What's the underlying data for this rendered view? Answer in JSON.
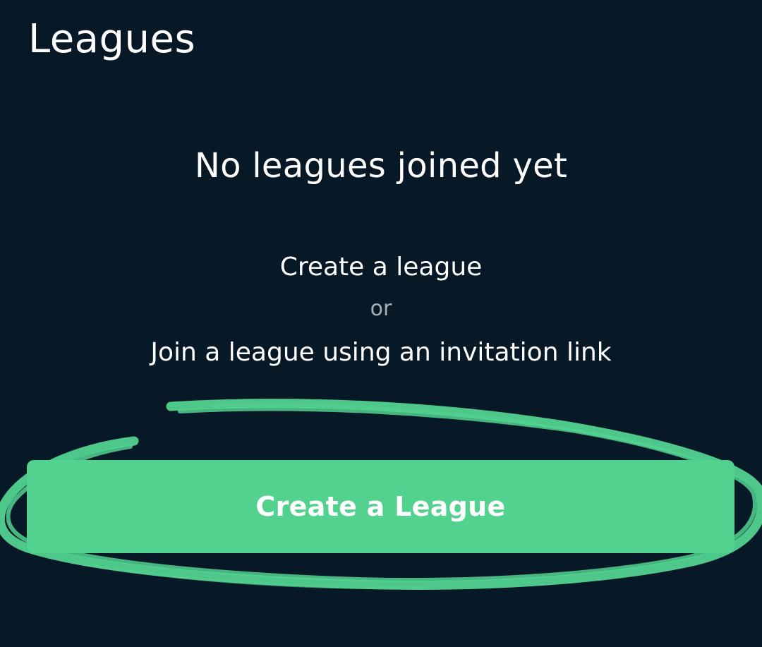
{
  "header": {
    "title": "Leagues"
  },
  "empty_state": {
    "title": "No leagues joined yet",
    "line_create": "Create a league",
    "line_or": "or",
    "line_join": "Join a league using an invitation link"
  },
  "actions": {
    "create_label": "Create a League"
  },
  "colors": {
    "background": "#071827",
    "accent": "#52d18f",
    "text_primary": "#ffffff",
    "text_secondary": "#a6b0bb"
  }
}
